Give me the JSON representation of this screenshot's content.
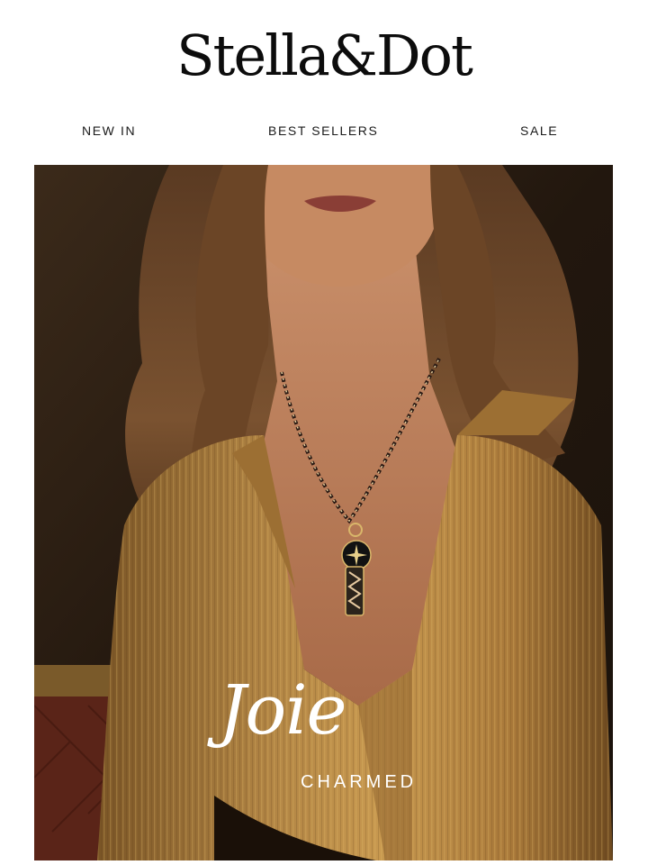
{
  "brand": {
    "logo_text": "Stella&Dot"
  },
  "nav": {
    "items": [
      {
        "label": "NEW IN"
      },
      {
        "label": "BEST SELLERS"
      },
      {
        "label": "SALE"
      }
    ]
  },
  "hero": {
    "title": "Joie",
    "subtitle": "CHARMED"
  },
  "colors": {
    "background": "#ffffff",
    "text": "#111111",
    "hero_text": "#ffffff",
    "blouse_gold": "#a87a3a",
    "backdrop_dark": "#2a1d12"
  }
}
